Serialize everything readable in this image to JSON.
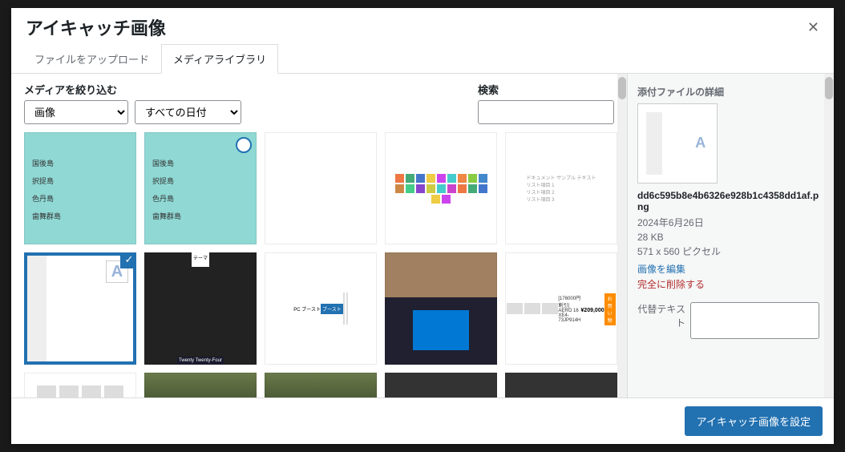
{
  "modal": {
    "title": "アイキャッチ画像",
    "close": "✕"
  },
  "tabs": {
    "upload": "ファイルをアップロード",
    "library": "メディアライブラリ"
  },
  "filters": {
    "label": "メディアを絞り込む",
    "type_selected": "画像",
    "date_selected": "すべての日付"
  },
  "search": {
    "label": "検索",
    "value": ""
  },
  "grid": {
    "items": [
      {
        "id": "map1",
        "kind": "map"
      },
      {
        "id": "map2",
        "kind": "map",
        "badge": true
      },
      {
        "id": "table",
        "kind": "tbl"
      },
      {
        "id": "keyboard",
        "kind": "kb"
      },
      {
        "id": "doc",
        "kind": "doc"
      },
      {
        "id": "wpedit",
        "kind": "wp",
        "selected": true
      },
      {
        "id": "site",
        "kind": "site"
      },
      {
        "id": "panel",
        "kind": "panel"
      },
      {
        "id": "laptop",
        "kind": "laptop"
      },
      {
        "id": "shop",
        "kind": "shop"
      },
      {
        "id": "prods",
        "kind": "prods"
      },
      {
        "id": "forest1",
        "kind": "forest"
      },
      {
        "id": "forest2",
        "kind": "forest"
      },
      {
        "id": "dark1",
        "kind": "dark"
      },
      {
        "id": "dark2",
        "kind": "dark"
      }
    ]
  },
  "details": {
    "heading": "添付ファイルの詳細",
    "filename": "dd6c595b8e4b6326e928b1c4358dd1af.png",
    "date": "2024年6月26日",
    "size": "28 KB",
    "dimensions": "571 x 560 ピクセル",
    "edit": "画像を編集",
    "delete": "完全に削除する",
    "alt_label": "代替テキスト",
    "alt_value": ""
  },
  "footer": {
    "submit": "アイキャッチ画像を設定"
  },
  "shop_price": "¥209,000",
  "shop_discount": "[176000円割引] AERO 16 XE4-73JP914H",
  "panel_btn": "ブースト",
  "site_theme": "Twenty Twenty-Four"
}
